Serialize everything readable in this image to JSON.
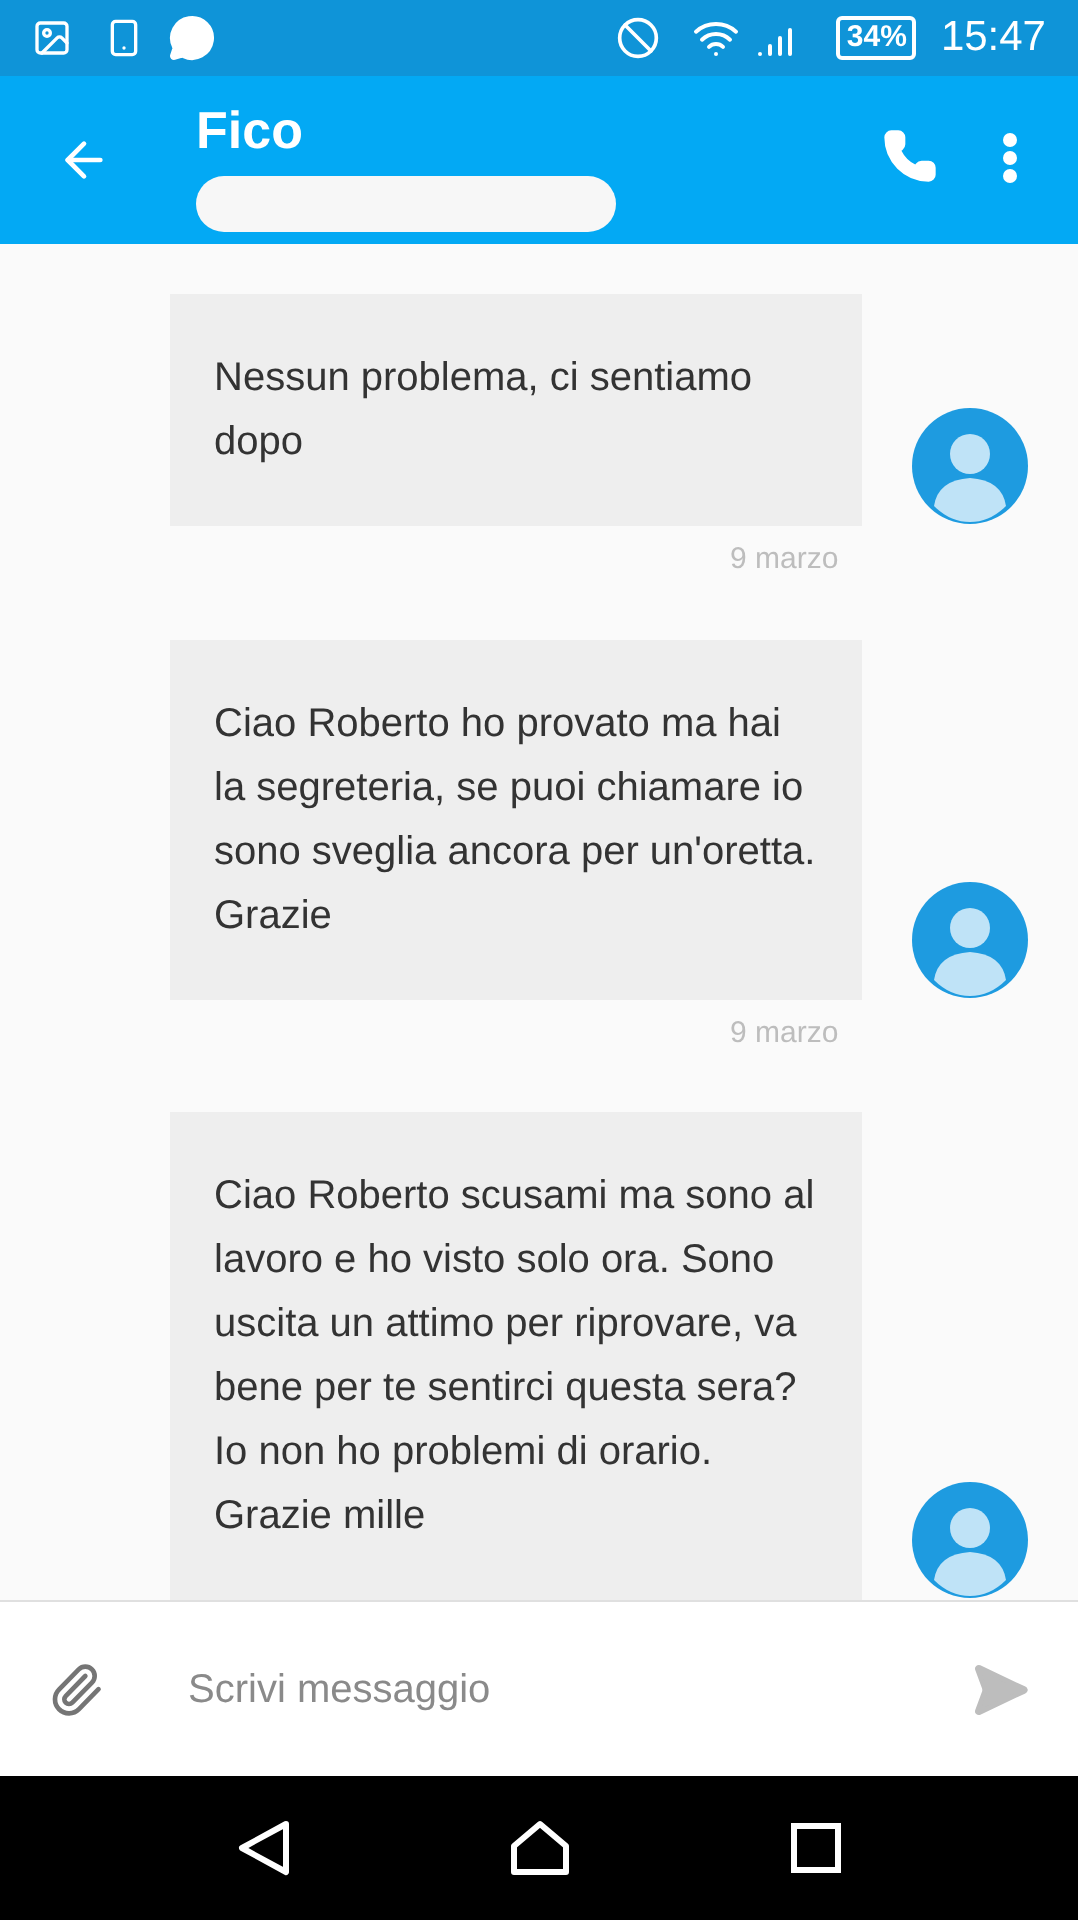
{
  "status_bar": {
    "battery": "34%",
    "time": "15:47"
  },
  "app_bar": {
    "title": "Fico"
  },
  "messages": [
    {
      "text": "Nessun problema,  ci sentiamo dopo",
      "date": "9 marzo"
    },
    {
      "text": "Ciao Roberto ho provato ma hai la segreteria, se puoi chiamare io sono sveglia ancora per un'oretta. Grazie",
      "date": "9 marzo"
    },
    {
      "text": "Ciao Roberto scusami ma sono al lavoro e ho visto solo ora.  Sono uscita un attimo per riprovare,  va bene per te sentirci questa sera? Io non ho problemi di orario.  Grazie mille"
    }
  ],
  "composer": {
    "placeholder": "Scrivi messaggio"
  }
}
